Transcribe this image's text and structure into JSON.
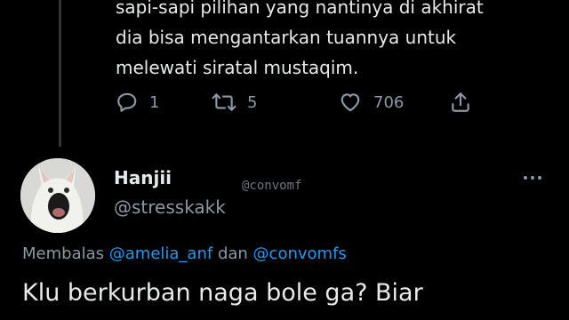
{
  "previous_tweet": {
    "lines": [
      "sapi-sapi pilihan yang nantinya di akhirat",
      "dia bisa mengantarkan tuannya untuk",
      "melewati siratal mustaqim."
    ],
    "actions": {
      "reply_count": "1",
      "retweet_count": "5",
      "like_count": "706"
    }
  },
  "reply_tweet": {
    "display_name": "Hanjii",
    "handle": "@stresskakk",
    "watermark": "@convomf",
    "replying_prefix": "Membalas",
    "mention_1": "@amelia_anf",
    "conjunction": "dan",
    "mention_2": "@convomfs",
    "text": "Klu berkurban naga bole ga? Biar"
  },
  "icons": {
    "reply": "reply-icon",
    "retweet": "retweet-icon",
    "like": "heart-icon",
    "share": "share-icon",
    "more": "more-dots-icon"
  },
  "colors": {
    "background": "#000000",
    "text": "#e7e9ea",
    "muted": "#8b98a5",
    "link": "#1d9bf0"
  }
}
